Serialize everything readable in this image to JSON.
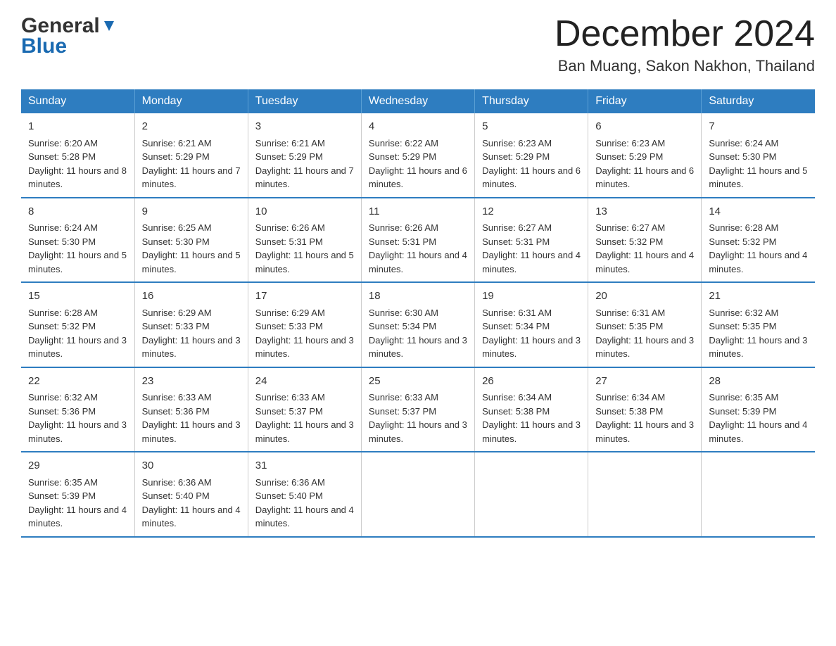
{
  "header": {
    "logo_general": "General",
    "logo_blue": "Blue",
    "month_title": "December 2024",
    "location": "Ban Muang, Sakon Nakhon, Thailand"
  },
  "days_of_week": [
    "Sunday",
    "Monday",
    "Tuesday",
    "Wednesday",
    "Thursday",
    "Friday",
    "Saturday"
  ],
  "weeks": [
    [
      {
        "day": "1",
        "sunrise": "6:20 AM",
        "sunset": "5:28 PM",
        "daylight": "11 hours and 8 minutes."
      },
      {
        "day": "2",
        "sunrise": "6:21 AM",
        "sunset": "5:29 PM",
        "daylight": "11 hours and 7 minutes."
      },
      {
        "day": "3",
        "sunrise": "6:21 AM",
        "sunset": "5:29 PM",
        "daylight": "11 hours and 7 minutes."
      },
      {
        "day": "4",
        "sunrise": "6:22 AM",
        "sunset": "5:29 PM",
        "daylight": "11 hours and 6 minutes."
      },
      {
        "day": "5",
        "sunrise": "6:23 AM",
        "sunset": "5:29 PM",
        "daylight": "11 hours and 6 minutes."
      },
      {
        "day": "6",
        "sunrise": "6:23 AM",
        "sunset": "5:29 PM",
        "daylight": "11 hours and 6 minutes."
      },
      {
        "day": "7",
        "sunrise": "6:24 AM",
        "sunset": "5:30 PM",
        "daylight": "11 hours and 5 minutes."
      }
    ],
    [
      {
        "day": "8",
        "sunrise": "6:24 AM",
        "sunset": "5:30 PM",
        "daylight": "11 hours and 5 minutes."
      },
      {
        "day": "9",
        "sunrise": "6:25 AM",
        "sunset": "5:30 PM",
        "daylight": "11 hours and 5 minutes."
      },
      {
        "day": "10",
        "sunrise": "6:26 AM",
        "sunset": "5:31 PM",
        "daylight": "11 hours and 5 minutes."
      },
      {
        "day": "11",
        "sunrise": "6:26 AM",
        "sunset": "5:31 PM",
        "daylight": "11 hours and 4 minutes."
      },
      {
        "day": "12",
        "sunrise": "6:27 AM",
        "sunset": "5:31 PM",
        "daylight": "11 hours and 4 minutes."
      },
      {
        "day": "13",
        "sunrise": "6:27 AM",
        "sunset": "5:32 PM",
        "daylight": "11 hours and 4 minutes."
      },
      {
        "day": "14",
        "sunrise": "6:28 AM",
        "sunset": "5:32 PM",
        "daylight": "11 hours and 4 minutes."
      }
    ],
    [
      {
        "day": "15",
        "sunrise": "6:28 AM",
        "sunset": "5:32 PM",
        "daylight": "11 hours and 3 minutes."
      },
      {
        "day": "16",
        "sunrise": "6:29 AM",
        "sunset": "5:33 PM",
        "daylight": "11 hours and 3 minutes."
      },
      {
        "day": "17",
        "sunrise": "6:29 AM",
        "sunset": "5:33 PM",
        "daylight": "11 hours and 3 minutes."
      },
      {
        "day": "18",
        "sunrise": "6:30 AM",
        "sunset": "5:34 PM",
        "daylight": "11 hours and 3 minutes."
      },
      {
        "day": "19",
        "sunrise": "6:31 AM",
        "sunset": "5:34 PM",
        "daylight": "11 hours and 3 minutes."
      },
      {
        "day": "20",
        "sunrise": "6:31 AM",
        "sunset": "5:35 PM",
        "daylight": "11 hours and 3 minutes."
      },
      {
        "day": "21",
        "sunrise": "6:32 AM",
        "sunset": "5:35 PM",
        "daylight": "11 hours and 3 minutes."
      }
    ],
    [
      {
        "day": "22",
        "sunrise": "6:32 AM",
        "sunset": "5:36 PM",
        "daylight": "11 hours and 3 minutes."
      },
      {
        "day": "23",
        "sunrise": "6:33 AM",
        "sunset": "5:36 PM",
        "daylight": "11 hours and 3 minutes."
      },
      {
        "day": "24",
        "sunrise": "6:33 AM",
        "sunset": "5:37 PM",
        "daylight": "11 hours and 3 minutes."
      },
      {
        "day": "25",
        "sunrise": "6:33 AM",
        "sunset": "5:37 PM",
        "daylight": "11 hours and 3 minutes."
      },
      {
        "day": "26",
        "sunrise": "6:34 AM",
        "sunset": "5:38 PM",
        "daylight": "11 hours and 3 minutes."
      },
      {
        "day": "27",
        "sunrise": "6:34 AM",
        "sunset": "5:38 PM",
        "daylight": "11 hours and 3 minutes."
      },
      {
        "day": "28",
        "sunrise": "6:35 AM",
        "sunset": "5:39 PM",
        "daylight": "11 hours and 4 minutes."
      }
    ],
    [
      {
        "day": "29",
        "sunrise": "6:35 AM",
        "sunset": "5:39 PM",
        "daylight": "11 hours and 4 minutes."
      },
      {
        "day": "30",
        "sunrise": "6:36 AM",
        "sunset": "5:40 PM",
        "daylight": "11 hours and 4 minutes."
      },
      {
        "day": "31",
        "sunrise": "6:36 AM",
        "sunset": "5:40 PM",
        "daylight": "11 hours and 4 minutes."
      },
      null,
      null,
      null,
      null
    ]
  ],
  "labels": {
    "sunrise": "Sunrise:",
    "sunset": "Sunset:",
    "daylight": "Daylight:"
  },
  "colors": {
    "header_bg": "#2e7dc0",
    "border_blue": "#2e7dc0"
  }
}
